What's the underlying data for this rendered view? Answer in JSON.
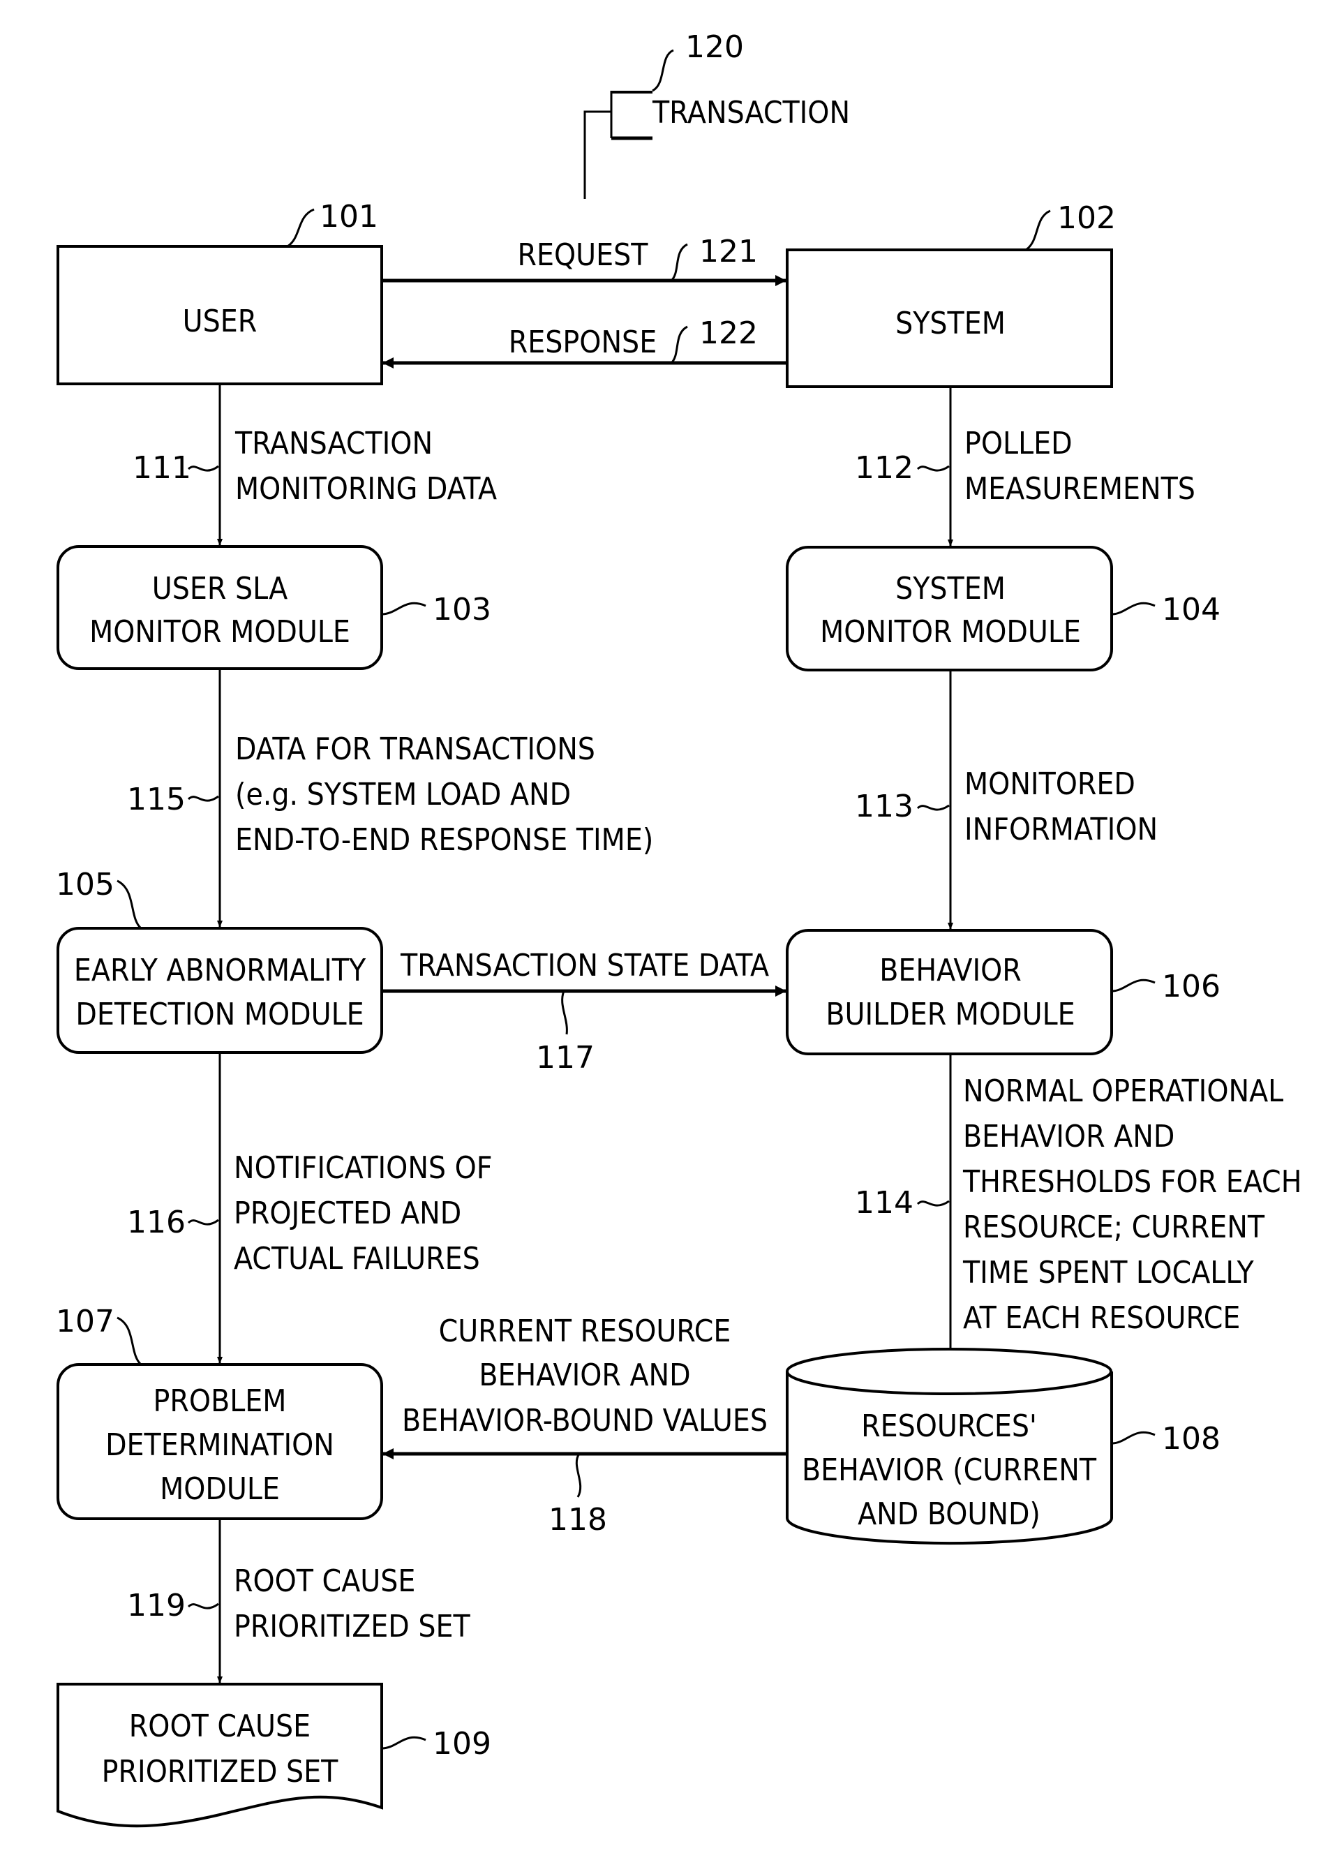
{
  "figure": {
    "transaction": {
      "label": "TRANSACTION",
      "ref": "120"
    },
    "nodes": {
      "user": {
        "ref": "101",
        "lines": [
          "USER"
        ]
      },
      "system": {
        "ref": "102",
        "lines": [
          "SYSTEM"
        ]
      },
      "user_sla": {
        "ref": "103",
        "lines": [
          "USER SLA",
          "MONITOR MODULE"
        ]
      },
      "system_monitor": {
        "ref": "104",
        "lines": [
          "SYSTEM",
          "MONITOR MODULE"
        ]
      },
      "early_abnormality": {
        "ref": "105",
        "lines": [
          "EARLY ABNORMALITY",
          "DETECTION MODULE"
        ]
      },
      "behavior_builder": {
        "ref": "106",
        "lines": [
          "BEHAVIOR",
          "BUILDER MODULE"
        ]
      },
      "problem_determination": {
        "ref": "107",
        "lines": [
          "PROBLEM",
          "DETERMINATION",
          "MODULE"
        ]
      },
      "resources_behavior": {
        "ref": "108",
        "lines": [
          "RESOURCES'",
          "BEHAVIOR (CURRENT",
          "AND BOUND)"
        ]
      },
      "root_cause_set": {
        "ref": "109",
        "lines": [
          "ROOT CAUSE",
          "PRIORITIZED SET"
        ]
      }
    },
    "edges": {
      "request": {
        "ref": "121",
        "lines": [
          "REQUEST"
        ]
      },
      "response": {
        "ref": "122",
        "lines": [
          "RESPONSE"
        ]
      },
      "e111": {
        "ref": "111",
        "lines": [
          "TRANSACTION",
          "MONITORING DATA"
        ]
      },
      "e112": {
        "ref": "112",
        "lines": [
          "POLLED",
          "MEASUREMENTS"
        ]
      },
      "e115": {
        "ref": "115",
        "lines": [
          "DATA FOR TRANSACTIONS",
          "(e.g. SYSTEM LOAD AND",
          "END-TO-END RESPONSE TIME)"
        ]
      },
      "e113": {
        "ref": "113",
        "lines": [
          "MONITORED",
          "INFORMATION"
        ]
      },
      "e117": {
        "ref": "117",
        "lines": [
          "TRANSACTION STATE DATA"
        ]
      },
      "e116": {
        "ref": "116",
        "lines": [
          "NOTIFICATIONS OF",
          "PROJECTED AND",
          "ACTUAL FAILURES"
        ]
      },
      "e114": {
        "ref": "114",
        "lines": [
          "NORMAL OPERATIONAL",
          "BEHAVIOR AND",
          "THRESHOLDS FOR EACH",
          "RESOURCE; CURRENT",
          "TIME SPENT LOCALLY",
          "AT EACH RESOURCE"
        ]
      },
      "e118": {
        "ref": "118",
        "lines": [
          "CURRENT RESOURCE",
          "BEHAVIOR AND",
          "BEHAVIOR-BOUND VALUES"
        ]
      },
      "e119": {
        "ref": "119",
        "lines": [
          "ROOT CAUSE",
          "PRIORITIZED SET"
        ]
      }
    }
  }
}
